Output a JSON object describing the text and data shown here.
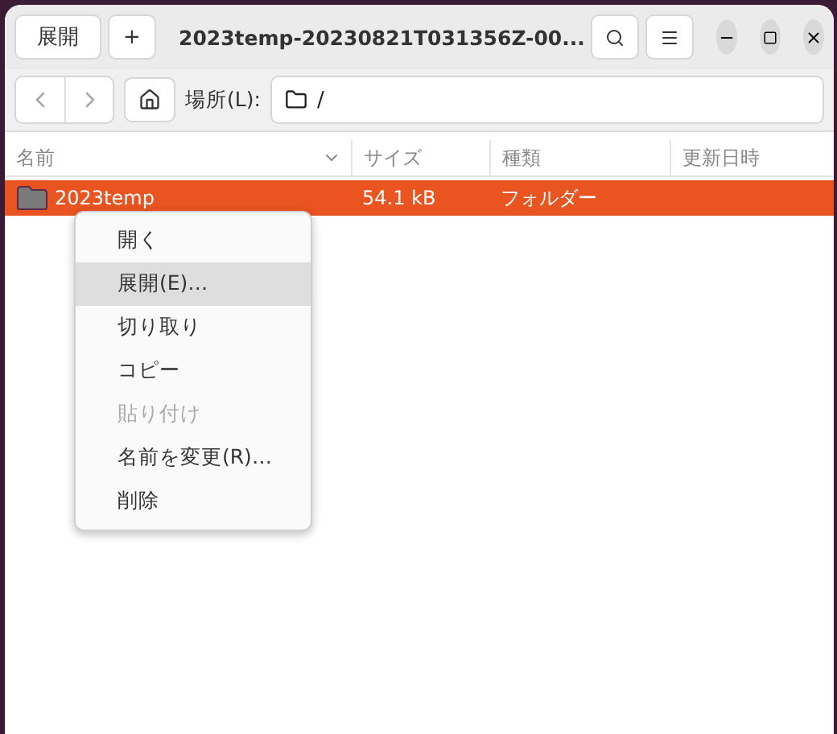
{
  "header": {
    "extract_button": "展開",
    "add_button": "+",
    "title": "2023temp-20230821T031356Z-00..."
  },
  "location": {
    "label": "場所(L):",
    "path": "/"
  },
  "columns": [
    {
      "label": "名前",
      "sorted": true
    },
    {
      "label": "サイズ",
      "sorted": false
    },
    {
      "label": "種類",
      "sorted": false
    },
    {
      "label": "更新日時",
      "sorted": false
    }
  ],
  "rows": [
    {
      "name": "2023temp",
      "size": "54.1 kB",
      "type": "フォルダー",
      "selected": true
    }
  ],
  "context_menu": [
    {
      "label": "開く",
      "highlighted": false,
      "disabled": false
    },
    {
      "label": "展開(E)…",
      "highlighted": true,
      "disabled": false
    },
    {
      "label": "切り取り",
      "highlighted": false,
      "disabled": false
    },
    {
      "label": "コピー",
      "highlighted": false,
      "disabled": false
    },
    {
      "label": "貼り付け",
      "highlighted": false,
      "disabled": true
    },
    {
      "label": "名前を変更(R)…",
      "highlighted": false,
      "disabled": false
    },
    {
      "label": "削除",
      "highlighted": false,
      "disabled": false
    }
  ]
}
